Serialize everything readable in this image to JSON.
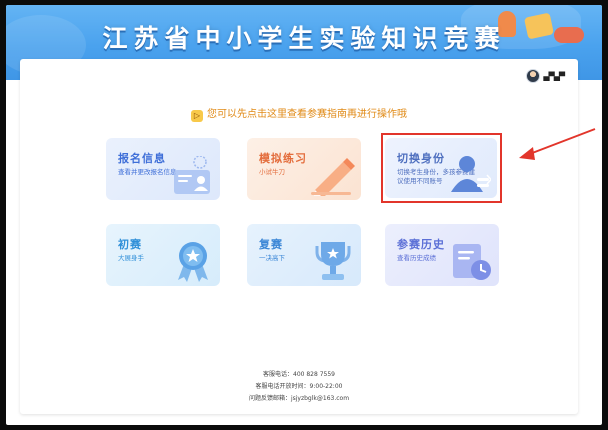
{
  "banner": {
    "title": "江苏省中小学生实验知识竞赛"
  },
  "user": {
    "name": "▄▀▄▀"
  },
  "tip": {
    "icon": "play-icon",
    "text": "您可以先点击这里查看参赛指南再进行操作哦"
  },
  "cards": [
    {
      "title": "报名信息",
      "subtitle": "查看并更改报名信息",
      "icon": "id-card-icon",
      "color": "#3f6fd8"
    },
    {
      "title": "模拟练习",
      "subtitle": "小试牛刀",
      "icon": "pencil-icon",
      "color": "#e36c3b"
    },
    {
      "title": "切换身份",
      "subtitle": "切换考生身份，多孩参赛建议使用不同账号",
      "icon": "user-switch-icon",
      "color": "#4e6fbf",
      "highlighted": true
    },
    {
      "title": "初赛",
      "subtitle": "大展身手",
      "icon": "medal-icon",
      "color": "#2f8fd8"
    },
    {
      "title": "复赛",
      "subtitle": "一决高下",
      "icon": "trophy-icon",
      "color": "#3a86d6"
    },
    {
      "title": "参赛历史",
      "subtitle": "查看历史成绩",
      "icon": "history-icon",
      "color": "#5b6fd6"
    }
  ],
  "annotation": {
    "arrow_color": "#e2352b"
  },
  "footer": {
    "phone": "客服电话：400 828 7559",
    "hours": "客服电话开放时间：9:00-22:00",
    "email": "问题反馈邮箱：jsjyzbglk@163.com"
  }
}
